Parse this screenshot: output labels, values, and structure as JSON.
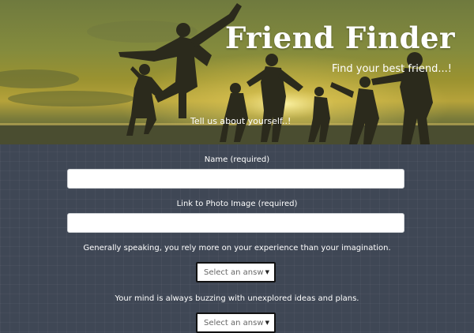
{
  "header": {
    "title": "Friend Finder",
    "subtitle": "Find your best friend...!",
    "intro": "Tell us about yourself..!"
  },
  "form": {
    "name_label": "Name (required)",
    "name_value": "",
    "photo_label": "Link to Photo Image (required)",
    "photo_value": "",
    "questions": [
      {
        "text": "Generally speaking, you rely more on your experience than your imagination.",
        "selected": "Select an answer"
      },
      {
        "text": "Your mind is always buzzing with unexplored ideas and plans.",
        "selected": "Select an answer"
      }
    ]
  },
  "icons": {
    "dropdown": "chevron-down-icon"
  },
  "colors": {
    "background": "#3f4755",
    "hero_tint": "#8a8c38",
    "text": "#ffffff"
  }
}
